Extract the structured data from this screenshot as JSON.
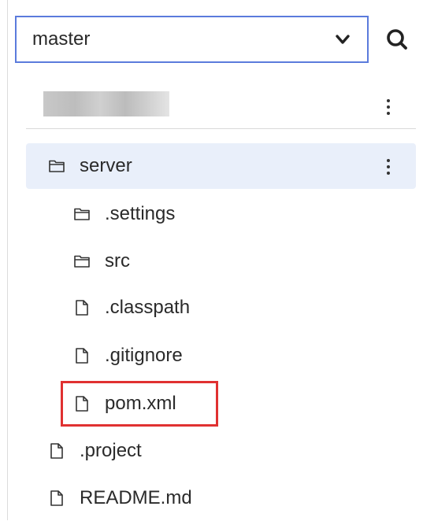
{
  "branch": {
    "selected": "master",
    "dropdown_icon": "chevron-down-icon",
    "search_icon": "search-icon",
    "accent_color": "#5b7bdc"
  },
  "repo": {
    "name_redacted": true,
    "menu_icon": "more-vertical-icon"
  },
  "tree": {
    "selected_folder": {
      "label": "server",
      "icon": "folder-icon",
      "menu_icon": "more-vertical-icon",
      "highlight_color": "#e9effa"
    },
    "children": [
      {
        "label": ".settings",
        "icon": "folder-icon"
      },
      {
        "label": "src",
        "icon": "folder-icon"
      },
      {
        "label": ".classpath",
        "icon": "file-icon"
      },
      {
        "label": ".gitignore",
        "icon": "file-icon"
      },
      {
        "label": "pom.xml",
        "icon": "file-icon",
        "annotated": true
      }
    ],
    "root_files": [
      {
        "label": ".project",
        "icon": "file-icon"
      },
      {
        "label": "README.md",
        "icon": "file-icon"
      }
    ]
  },
  "annotation_color": "#e03131"
}
